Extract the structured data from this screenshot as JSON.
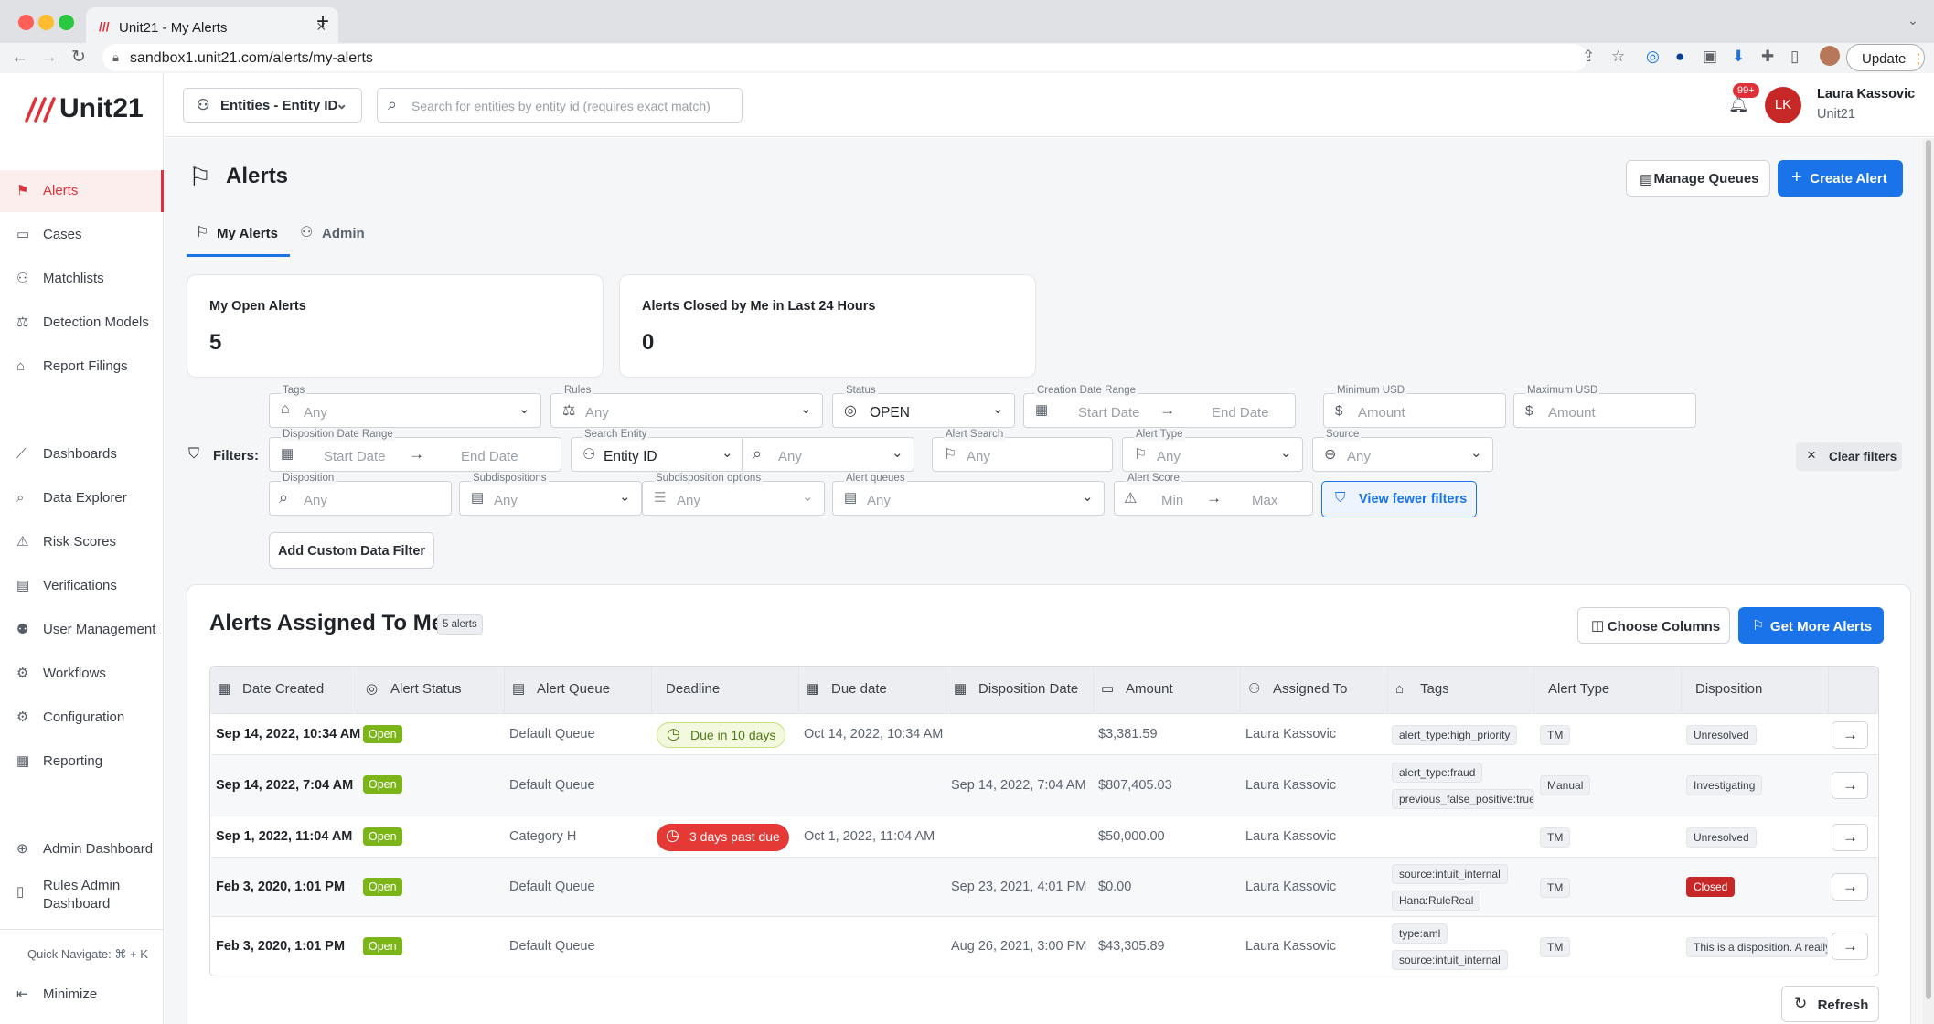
{
  "browser": {
    "tab_title": "Unit21 - My Alerts",
    "url": "sandbox1.unit21.com/alerts/my-alerts",
    "update_label": "Update"
  },
  "brand": {
    "name": "Unit21",
    "accent": "#e0313b",
    "primary": "#1a73e8"
  },
  "sidebar": {
    "items": [
      {
        "label": "Alerts",
        "icon": "flag-icon"
      },
      {
        "label": "Cases",
        "icon": "briefcase-icon"
      },
      {
        "label": "Matchlists",
        "icon": "user-list-icon"
      },
      {
        "label": "Detection Models",
        "icon": "scale-icon"
      },
      {
        "label": "Report Filings",
        "icon": "bank-icon"
      },
      {
        "label": "Dashboards",
        "icon": "chart-line-icon"
      },
      {
        "label": "Data Explorer",
        "icon": "search-data-icon"
      },
      {
        "label": "Risk Scores",
        "icon": "warning-icon"
      },
      {
        "label": "Verifications",
        "icon": "id-card-icon"
      },
      {
        "label": "User Management",
        "icon": "users-icon"
      },
      {
        "label": "Workflows",
        "icon": "workflow-icon"
      },
      {
        "label": "Configuration",
        "icon": "gear-icon"
      },
      {
        "label": "Reporting",
        "icon": "report-icon"
      },
      {
        "label": "Admin Dashboard",
        "icon": "globe-icon"
      },
      {
        "label_line1": "Rules Admin",
        "label_line2": "Dashboard",
        "icon": "clipboard-icon"
      }
    ],
    "quick_navigate": "Quick Navigate: ⌘ + K",
    "minimize": "Minimize"
  },
  "topbar": {
    "entity_selector": "Entities - Entity ID",
    "search_placeholder": "Search for entities by entity id (requires exact match)",
    "notification_badge": "99+",
    "user_initials": "LK",
    "user_name": "Laura Kassovic",
    "user_org": "Unit21"
  },
  "page": {
    "title": "Alerts",
    "manage_queues": "Manage Queues",
    "create_alert": "Create Alert",
    "tabs": [
      "My Alerts",
      "Admin"
    ]
  },
  "stats": [
    {
      "label": "My Open Alerts",
      "value": "5"
    },
    {
      "label": "Alerts Closed by Me in Last 24 Hours",
      "value": "0"
    }
  ],
  "filters": {
    "label": "Filters:",
    "tags": {
      "label": "Tags",
      "value": "Any"
    },
    "rules": {
      "label": "Rules",
      "value": "Any"
    },
    "status": {
      "label": "Status",
      "value": "OPEN"
    },
    "creation_date": {
      "label": "Creation Date Range",
      "start": "Start Date",
      "end": "End Date"
    },
    "min_usd": {
      "label": "Minimum USD",
      "value": "Amount"
    },
    "max_usd": {
      "label": "Maximum USD",
      "value": "Amount"
    },
    "disposition_date": {
      "label": "Disposition Date Range",
      "start": "Start Date",
      "end": "End Date"
    },
    "search_entity": {
      "label": "Search Entity",
      "value": "Entity ID"
    },
    "search_entity_any": "Any",
    "alert_search": {
      "label": "Alert Search",
      "value": "Any"
    },
    "alert_type": {
      "label": "Alert Type",
      "value": "Any"
    },
    "source": {
      "label": "Source",
      "value": "Any"
    },
    "disposition": {
      "label": "Disposition",
      "value": "Any"
    },
    "subdispositions": {
      "label": "Subdispositions",
      "value": "Any"
    },
    "subdisposition_options": {
      "label": "Subdisposition options",
      "value": "Any"
    },
    "alert_queues": {
      "label": "Alert queues",
      "value": "Any"
    },
    "alert_score": {
      "label": "Alert Score",
      "min": "Min",
      "max": "Max"
    },
    "view_fewer": "View fewer filters",
    "clear": "Clear filters",
    "add_custom": "Add Custom Data Filter"
  },
  "table": {
    "title": "Alerts Assigned To Me",
    "count_badge": "5 alerts",
    "choose_columns": "Choose Columns",
    "get_more": "Get More Alerts",
    "refresh": "Refresh",
    "columns": [
      "Date Created",
      "Alert Status",
      "Alert Queue",
      "Deadline",
      "Due date",
      "Disposition Date",
      "Amount",
      "Assigned To",
      "Tags",
      "Alert Type",
      "Disposition"
    ],
    "rows": [
      {
        "date": "Sep 14, 2022, 10:34 AM",
        "status": "Open",
        "queue": "Default Queue",
        "deadline": "Due in 10 days",
        "due": "Oct 14, 2022, 10:34 AM",
        "disp_date": "",
        "amount": "$3,381.59",
        "assigned": "Laura Kassovic",
        "tags": [
          "alert_type:high_priority"
        ],
        "type": "TM",
        "disposition": "Unresolved"
      },
      {
        "date": "Sep 14, 2022, 7:04 AM",
        "status": "Open",
        "queue": "Default Queue",
        "deadline": "",
        "due": "",
        "disp_date": "Sep 14, 2022, 7:04 AM",
        "amount": "$807,405.03",
        "assigned": "Laura Kassovic",
        "tags": [
          "alert_type:fraud",
          "previous_false_positive:true"
        ],
        "type": "Manual",
        "disposition": "Investigating"
      },
      {
        "date": "Sep 1, 2022, 11:04 AM",
        "status": "Open",
        "queue": "Category H",
        "deadline": "3 days past due",
        "due": "Oct 1, 2022, 11:04 AM",
        "disp_date": "",
        "amount": "$50,000.00",
        "assigned": "Laura Kassovic",
        "tags": [],
        "type": "TM",
        "disposition": "Unresolved"
      },
      {
        "date": "Feb 3, 2020, 1:01 PM",
        "status": "Open",
        "queue": "Default Queue",
        "deadline": "",
        "due": "",
        "disp_date": "Sep 23, 2021, 4:01 PM",
        "amount": "$0.00",
        "assigned": "Laura Kassovic",
        "tags": [
          "source:intuit_internal",
          "Hana:RuleReal"
        ],
        "type": "TM",
        "disposition": "Closed"
      },
      {
        "date": "Feb 3, 2020, 1:01 PM",
        "status": "Open",
        "queue": "Default Queue",
        "deadline": "",
        "due": "",
        "disp_date": "Aug 26, 2021, 3:00 PM",
        "amount": "$43,305.89",
        "assigned": "Laura Kassovic",
        "tags": [
          "type:aml",
          "source:intuit_internal"
        ],
        "type": "TM",
        "disposition": "This is a disposition. A really"
      }
    ]
  }
}
